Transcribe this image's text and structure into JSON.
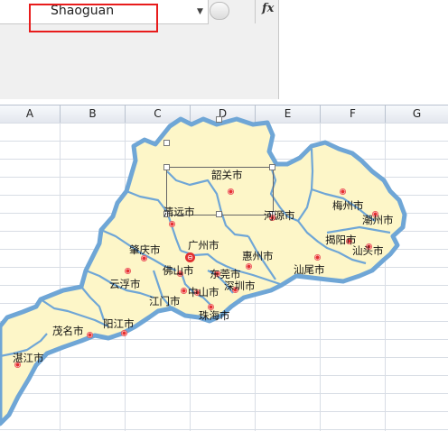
{
  "name_box": {
    "value": "Shaoguan"
  },
  "formula_bar": {
    "fx_label": "fx",
    "value": ""
  },
  "columns": [
    "A",
    "B",
    "C",
    "D",
    "E",
    "F",
    "G"
  ],
  "colors": {
    "map_fill": "#fdf6c8",
    "map_border": "#6fa6d6",
    "highlight": "#e81c1c"
  },
  "cities": [
    {
      "name": "韶关市"
    },
    {
      "name": "清远市"
    },
    {
      "name": "河源市"
    },
    {
      "name": "梅州市"
    },
    {
      "name": "潮州市"
    },
    {
      "name": "揭阳市"
    },
    {
      "name": "汕头市"
    },
    {
      "name": "肇庆市"
    },
    {
      "name": "广州市"
    },
    {
      "name": "惠州市"
    },
    {
      "name": "佛山市"
    },
    {
      "name": "东莞市"
    },
    {
      "name": "汕尾市"
    },
    {
      "name": "云浮市"
    },
    {
      "name": "深圳市"
    },
    {
      "name": "江门市"
    },
    {
      "name": "中山市"
    },
    {
      "name": "珠海市"
    },
    {
      "name": "茂名市"
    },
    {
      "name": "阳江市"
    },
    {
      "name": "湛江市"
    }
  ]
}
